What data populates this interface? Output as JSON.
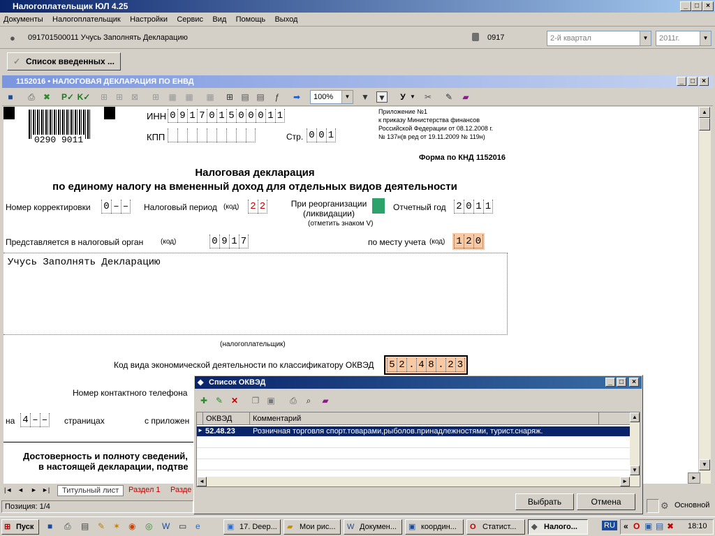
{
  "app": {
    "title": "Налогоплательщик ЮЛ 4.25"
  },
  "menu": [
    "Документы",
    "Налогоплательщик",
    "Настройки",
    "Сервис",
    "Вид",
    "Помощь",
    "Выход"
  ],
  "org": {
    "name": "091701500011 Учусь Заполнять Декларацию",
    "code": "0917",
    "period": "2-й квартал",
    "year": "2011г."
  },
  "tabs": {
    "list": "Список введенных ..."
  },
  "doc": {
    "title": "1152016 • НАЛОГОВАЯ ДЕКЛАРАЦИЯ ПО ЕНВД",
    "zoom": "100%"
  },
  "form": {
    "barcode": "0290 9011",
    "inn_label": "ИНН",
    "inn": [
      "0",
      "9",
      "1",
      "7",
      "0",
      "1",
      "5",
      "0",
      "0",
      "0",
      "1",
      "1"
    ],
    "kpp_label": "КПП",
    "page_label": "Стр.",
    "page": [
      "0",
      "0",
      "1"
    ],
    "appendix": [
      "Приложение №1",
      "к приказу Министерства финансов",
      "Российской Федерации от  08.12.2008 г.",
      "№ 137н(в ред от 19.11.2009 № 119н)"
    ],
    "form_code": "Форма по КНД 1152016",
    "heading1": "Налоговая декларация",
    "heading2": "по единому налогу на вмененный доход для отдельных видов деятельности",
    "corr_label": "Номер корректировки",
    "corr": [
      "0",
      "–",
      "–"
    ],
    "period_label": "Налоговый период",
    "code_label": "(код)",
    "period": [
      "2",
      "2"
    ],
    "reorg_label1": "При реорганизации",
    "reorg_label2": "(ликвидации)",
    "reorg_note": "(отметить знаком V)",
    "year_label": "Отчетный год",
    "year": [
      "2",
      "0",
      "1",
      "1"
    ],
    "organ_label": "Представляется в налоговый орган",
    "organ": [
      "0",
      "9",
      "1",
      "7"
    ],
    "place_label": "по месту учета",
    "place": [
      "1",
      "2",
      "0"
    ],
    "taxpayer_name": "Учусь Заполнять Декларацию",
    "taxpayer_caption": "(налогоплательщик)",
    "okved_label": "Код вида экономической деятельности по классификатору ОКВЭД",
    "okved": [
      "5",
      "2",
      ".",
      "4",
      "8",
      ".",
      "2",
      "3"
    ],
    "phone_label": "Номер контактного телефона",
    "na_label": "на",
    "pages": [
      "4",
      "–",
      "–"
    ],
    "pages_label": "страницах",
    "attach_label": "с приложен",
    "confirm1": "Достоверность и полноту сведений,",
    "confirm2": "в настоящей декларации, подтве"
  },
  "sheets": [
    "Титульный лист",
    "Раздел 1",
    "Разде"
  ],
  "status": {
    "position": "Позиция: 1/4",
    "mode": "Основной"
  },
  "okved_dialog": {
    "title": "Список ОКВЭД",
    "col_okved": "ОКВЭД",
    "col_comment": "Комментарий",
    "rows": [
      {
        "code": "52.48.23",
        "comment": "Розничная торговля спорт.товарами,рыболов.принадлежностями, турист.снаряж."
      }
    ],
    "select": "Выбрать",
    "cancel": "Отмена"
  },
  "taskbar": {
    "start": "Пуск",
    "tasks": [
      "17. Deep...",
      "Мои рис...",
      "Докумен...",
      "координ...",
      "Статист...",
      "Налого..."
    ],
    "lang": "RU",
    "clock": "18:10"
  }
}
